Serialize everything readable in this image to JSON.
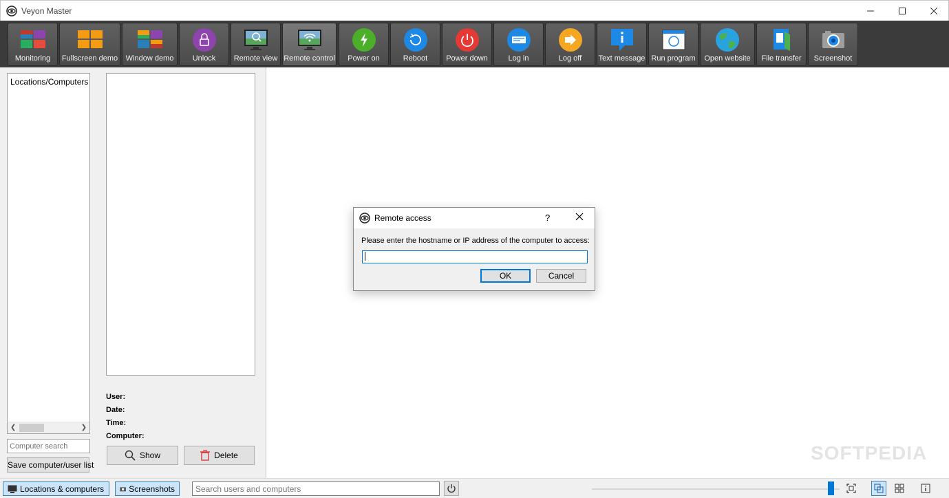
{
  "window": {
    "title": "Veyon Master"
  },
  "toolbar": [
    {
      "label": "Monitoring",
      "icon": "monitoring-icon"
    },
    {
      "label": "Fullscreen demo",
      "icon": "fullscreen-demo-icon"
    },
    {
      "label": "Window demo",
      "icon": "window-demo-icon"
    },
    {
      "label": "Unlock",
      "icon": "unlock-icon"
    },
    {
      "label": "Remote view",
      "icon": "remote-view-icon"
    },
    {
      "label": "Remote control",
      "icon": "remote-control-icon"
    },
    {
      "label": "Power on",
      "icon": "power-on-icon"
    },
    {
      "label": "Reboot",
      "icon": "reboot-icon"
    },
    {
      "label": "Power down",
      "icon": "power-down-icon"
    },
    {
      "label": "Log in",
      "icon": "log-in-icon"
    },
    {
      "label": "Log off",
      "icon": "log-off-icon"
    },
    {
      "label": "Text message",
      "icon": "text-message-icon"
    },
    {
      "label": "Run program",
      "icon": "run-program-icon"
    },
    {
      "label": "Open website",
      "icon": "open-website-icon"
    },
    {
      "label": "File transfer",
      "icon": "file-transfer-icon"
    },
    {
      "label": "Screenshot",
      "icon": "screenshot-icon"
    }
  ],
  "locations_panel": {
    "header": "Locations/Computers",
    "search_placeholder": "Computer search",
    "save_label": "Save computer/user list"
  },
  "screenshot_panel": {
    "user_label": "User:",
    "date_label": "Date:",
    "time_label": "Time:",
    "computer_label": "Computer:",
    "show_label": "Show",
    "delete_label": "Delete"
  },
  "watermark": "SOFTPEDIA",
  "dialog": {
    "title": "Remote access",
    "help": "?",
    "prompt": "Please enter the hostname or IP address of the computer to access:",
    "input_value": "",
    "ok_label": "OK",
    "cancel_label": "Cancel"
  },
  "statusbar": {
    "locations_tab": "Locations & computers",
    "screenshots_tab": "Screenshots",
    "search_placeholder": "Search users and computers"
  }
}
